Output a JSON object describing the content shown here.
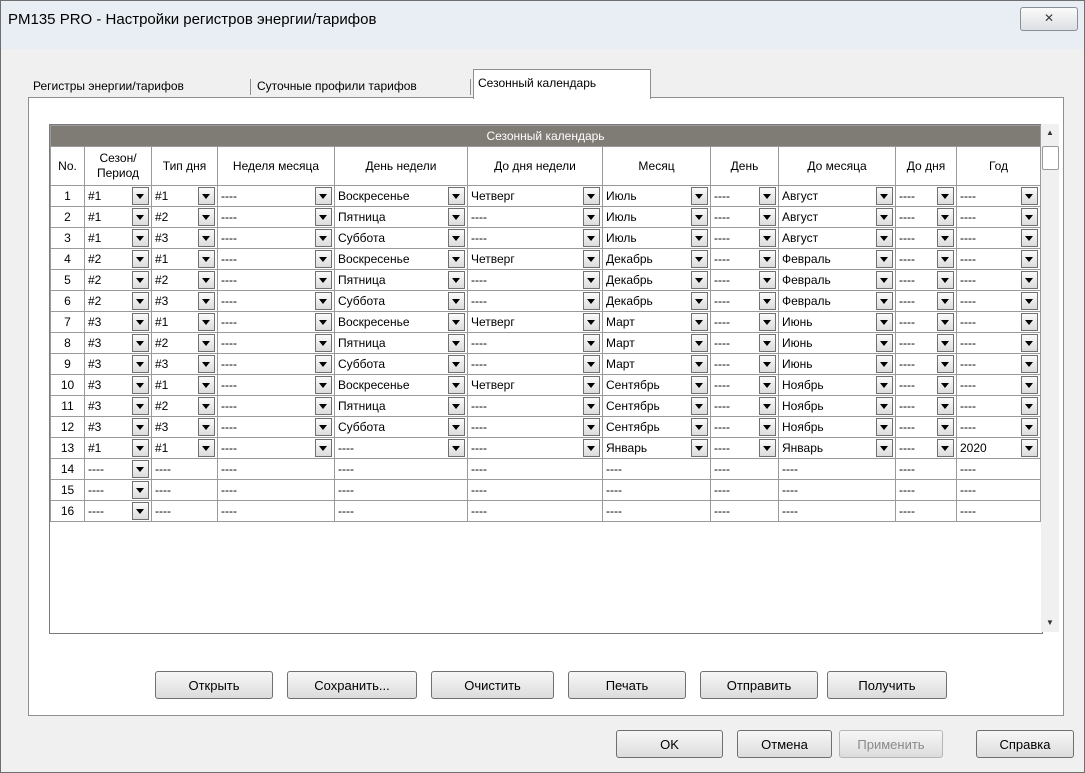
{
  "window": {
    "title": "PM135 PRO - Настройки регистров энергии/тарифов",
    "close_label": "✕"
  },
  "tabs": [
    "Регистры энергии/тарифов",
    "Суточные профили тарифов",
    "Сезонный календарь"
  ],
  "grid": {
    "caption": "Сезонный календарь",
    "headers": [
      "No.",
      "Сезон/ Период",
      "Тип дня",
      "Неделя месяца",
      "День недели",
      "До дня недели",
      "Месяц",
      "День",
      "До месяца",
      "До дня",
      "Год"
    ],
    "rows": [
      {
        "no": "1",
        "season": "#1",
        "daytype": "#1",
        "week": "----",
        "day": "Воскресенье",
        "today": "Четверг",
        "month": "Июль",
        "mday": "----",
        "tomonth": "Август",
        "tomday": "----",
        "year": "----"
      },
      {
        "no": "2",
        "season": "#1",
        "daytype": "#2",
        "week": "----",
        "day": "Пятница",
        "today": "----",
        "month": "Июль",
        "mday": "----",
        "tomonth": "Август",
        "tomday": "----",
        "year": "----"
      },
      {
        "no": "3",
        "season": "#1",
        "daytype": "#3",
        "week": "----",
        "day": "Суббота",
        "today": "----",
        "month": "Июль",
        "mday": "----",
        "tomonth": "Август",
        "tomday": "----",
        "year": "----"
      },
      {
        "no": "4",
        "season": "#2",
        "daytype": "#1",
        "week": "----",
        "day": "Воскресенье",
        "today": "Четверг",
        "month": "Декабрь",
        "mday": "----",
        "tomonth": "Февраль",
        "tomday": "----",
        "year": "----"
      },
      {
        "no": "5",
        "season": "#2",
        "daytype": "#2",
        "week": "----",
        "day": "Пятница",
        "today": "----",
        "month": "Декабрь",
        "mday": "----",
        "tomonth": "Февраль",
        "tomday": "----",
        "year": "----"
      },
      {
        "no": "6",
        "season": "#2",
        "daytype": "#3",
        "week": "----",
        "day": "Суббота",
        "today": "----",
        "month": "Декабрь",
        "mday": "----",
        "tomonth": "Февраль",
        "tomday": "----",
        "year": "----"
      },
      {
        "no": "7",
        "season": "#3",
        "daytype": "#1",
        "week": "----",
        "day": "Воскресенье",
        "today": "Четверг",
        "month": "Март",
        "mday": "----",
        "tomonth": "Июнь",
        "tomday": "----",
        "year": "----"
      },
      {
        "no": "8",
        "season": "#3",
        "daytype": "#2",
        "week": "----",
        "day": "Пятница",
        "today": "----",
        "month": "Март",
        "mday": "----",
        "tomonth": "Июнь",
        "tomday": "----",
        "year": "----"
      },
      {
        "no": "9",
        "season": "#3",
        "daytype": "#3",
        "week": "----",
        "day": "Суббота",
        "today": "----",
        "month": "Март",
        "mday": "----",
        "tomonth": "Июнь",
        "tomday": "----",
        "year": "----"
      },
      {
        "no": "10",
        "season": "#3",
        "daytype": "#1",
        "week": "----",
        "day": "Воскресенье",
        "today": "Четверг",
        "month": "Сентябрь",
        "mday": "----",
        "tomonth": "Ноябрь",
        "tomday": "----",
        "year": "----"
      },
      {
        "no": "11",
        "season": "#3",
        "daytype": "#2",
        "week": "----",
        "day": "Пятница",
        "today": "----",
        "month": "Сентябрь",
        "mday": "----",
        "tomonth": "Ноябрь",
        "tomday": "----",
        "year": "----"
      },
      {
        "no": "12",
        "season": "#3",
        "daytype": "#3",
        "week": "----",
        "day": "Суббота",
        "today": "----",
        "month": "Сентябрь",
        "mday": "----",
        "tomonth": "Ноябрь",
        "tomday": "----",
        "year": "----"
      },
      {
        "no": "13",
        "season": "#1",
        "daytype": "#1",
        "week": "----",
        "day": "----",
        "today": "----",
        "month": "Январь",
        "mday": "----",
        "tomonth": "Январь",
        "tomday": "----",
        "year": "2020"
      },
      {
        "no": "14",
        "season": "----",
        "daytype": "----",
        "week": "----",
        "day": "----",
        "today": "----",
        "month": "----",
        "mday": "----",
        "tomonth": "----",
        "tomday": "----",
        "year": "----",
        "empty": true
      },
      {
        "no": "15",
        "season": "----",
        "daytype": "----",
        "week": "----",
        "day": "----",
        "today": "----",
        "month": "----",
        "mday": "----",
        "tomonth": "----",
        "tomday": "----",
        "year": "----",
        "empty": true
      },
      {
        "no": "16",
        "season": "----",
        "daytype": "----",
        "week": "----",
        "day": "----",
        "today": "----",
        "month": "----",
        "mday": "----",
        "tomonth": "----",
        "tomday": "----",
        "year": "----",
        "empty": true
      }
    ]
  },
  "actions": [
    "Открыть",
    "Сохранить...",
    "Очистить",
    "Печать",
    "Отправить",
    "Получить"
  ],
  "dialog_buttons": {
    "ok": "OK",
    "cancel": "Отмена",
    "apply": "Применить",
    "help": "Справка"
  }
}
